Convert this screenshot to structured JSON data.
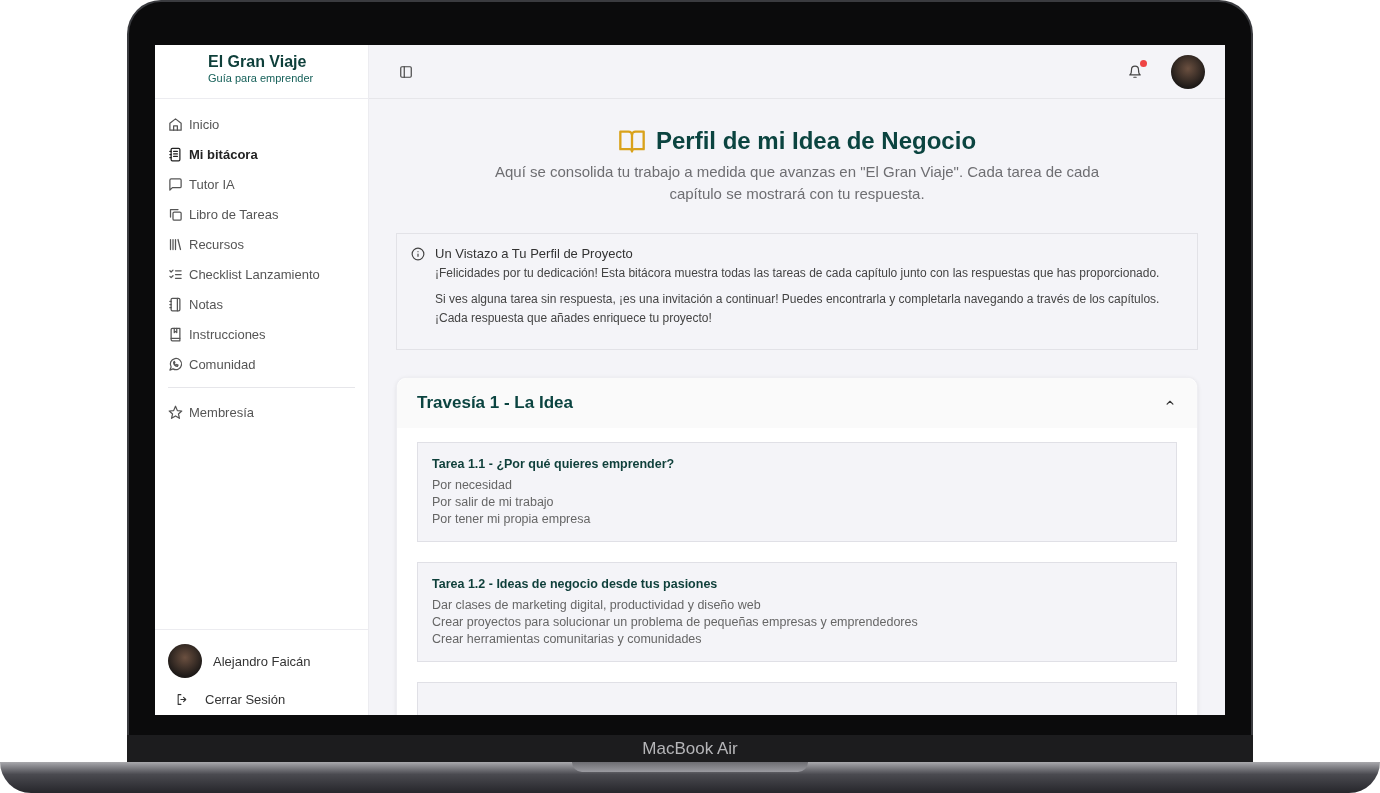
{
  "sidebar": {
    "brand": {
      "title": "El Gran Viaje",
      "subtitle": "Guía para emprender"
    },
    "items": [
      {
        "label": "Inicio",
        "selected": false
      },
      {
        "label": "Mi bitácora",
        "selected": true
      },
      {
        "label": "Tutor IA",
        "selected": false
      },
      {
        "label": "Libro de Tareas",
        "selected": false
      },
      {
        "label": "Recursos",
        "selected": false
      },
      {
        "label": "Checklist Lanzamiento",
        "selected": false
      },
      {
        "label": "Notas",
        "selected": false
      },
      {
        "label": "Instrucciones",
        "selected": false
      },
      {
        "label": "Comunidad",
        "selected": false
      }
    ],
    "footer_items": [
      {
        "label": "Membresía",
        "selected": false
      }
    ],
    "user": {
      "name": "Alejandro Faicán"
    },
    "logout": "Cerrar Sesión"
  },
  "topbar": {
    "notification_unread": true
  },
  "page": {
    "title": "Perfil de mi Idea de Negocio",
    "subtitle": "Aquí se consolida tu trabajo a medida que avanzas en \"El Gran Viaje\". Cada tarea de cada capítulo se mostrará con tu respuesta."
  },
  "info": {
    "title": "Un Vistazo a Tu Perfil de Proyecto",
    "paragraphs": [
      "¡Felicidades por tu dedicación! Esta bitácora muestra todas las tareas de cada capítulo junto con las respuestas que has proporcionado.",
      "Si ves alguna tarea sin respuesta, ¡es una invitación a continuar! Puedes encontrarla y completarla navegando a través de los capítulos. ¡Cada respuesta que añades enriquece tu proyecto!"
    ]
  },
  "sections": [
    {
      "title": "Travesía 1 - La Idea",
      "expanded": true,
      "tasks": [
        {
          "title": "Tarea 1.1 - ¿Por qué quieres emprender?",
          "answers": [
            "Por necesidad",
            "Por salir de mi trabajo",
            "Por tener mi propia empresa"
          ]
        },
        {
          "title": "Tarea 1.2 - Ideas de negocio desde tus pasiones",
          "answers": [
            "Dar clases de marketing digital, productividad y diseño web",
            "Crear proyectos para solucionar un problema de pequeñas empresas y emprendedores",
            "Crear herramientas comunitarias y comunidades"
          ]
        }
      ]
    }
  ],
  "device": {
    "label": "MacBook Air"
  }
}
